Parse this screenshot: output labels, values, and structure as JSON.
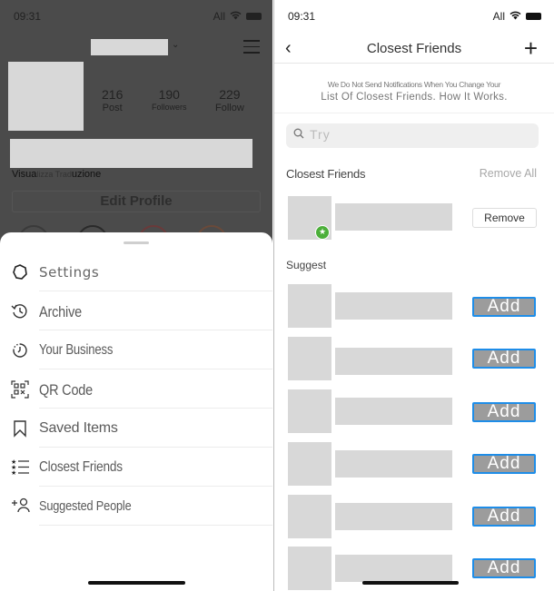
{
  "left": {
    "status": {
      "time": "09:31",
      "carrier": "All"
    },
    "profile": {
      "stats": [
        {
          "value": "216",
          "label": "Post"
        },
        {
          "value": "190",
          "label": "Followers"
        },
        {
          "value": "229",
          "label": "Follow"
        }
      ],
      "translate_pre": "Visua",
      "translate_mid": "lizza Trad",
      "translate_post": "uzione",
      "edit_profile": "Edit Profile"
    },
    "menu": [
      {
        "label": "Settings",
        "icon": "gear-icon"
      },
      {
        "label": "Archive",
        "icon": "archive-icon"
      },
      {
        "label": "Your Business",
        "icon": "business-icon"
      },
      {
        "label": "QR Code",
        "icon": "qr-code-icon"
      },
      {
        "label": "Saved Items",
        "icon": "bookmark-icon"
      },
      {
        "label": "Closest Friends",
        "icon": "star-list-icon"
      },
      {
        "label": "Suggested People",
        "icon": "add-person-icon"
      }
    ]
  },
  "right": {
    "status": {
      "time": "09:31",
      "carrier": "All"
    },
    "nav": {
      "title": "Closest Friends",
      "back": "‹",
      "add": "+"
    },
    "notice": {
      "line1": "We Do Not Send Notifications When You Change Your",
      "line2": "List Of Closest Friends. How It Works."
    },
    "search": {
      "value": "Try",
      "placeholder": "Search"
    },
    "closest_section": {
      "title": "Closest Friends",
      "remove_all": "Remove All"
    },
    "closest_friends": [
      {
        "action": "Remove"
      }
    ],
    "suggested_section": {
      "title": "Suggest"
    },
    "suggested": [
      {
        "action": "Add"
      },
      {
        "action": "Add"
      },
      {
        "action": "Add"
      },
      {
        "action": "Add"
      },
      {
        "action": "Add"
      },
      {
        "action": "Add"
      }
    ]
  }
}
